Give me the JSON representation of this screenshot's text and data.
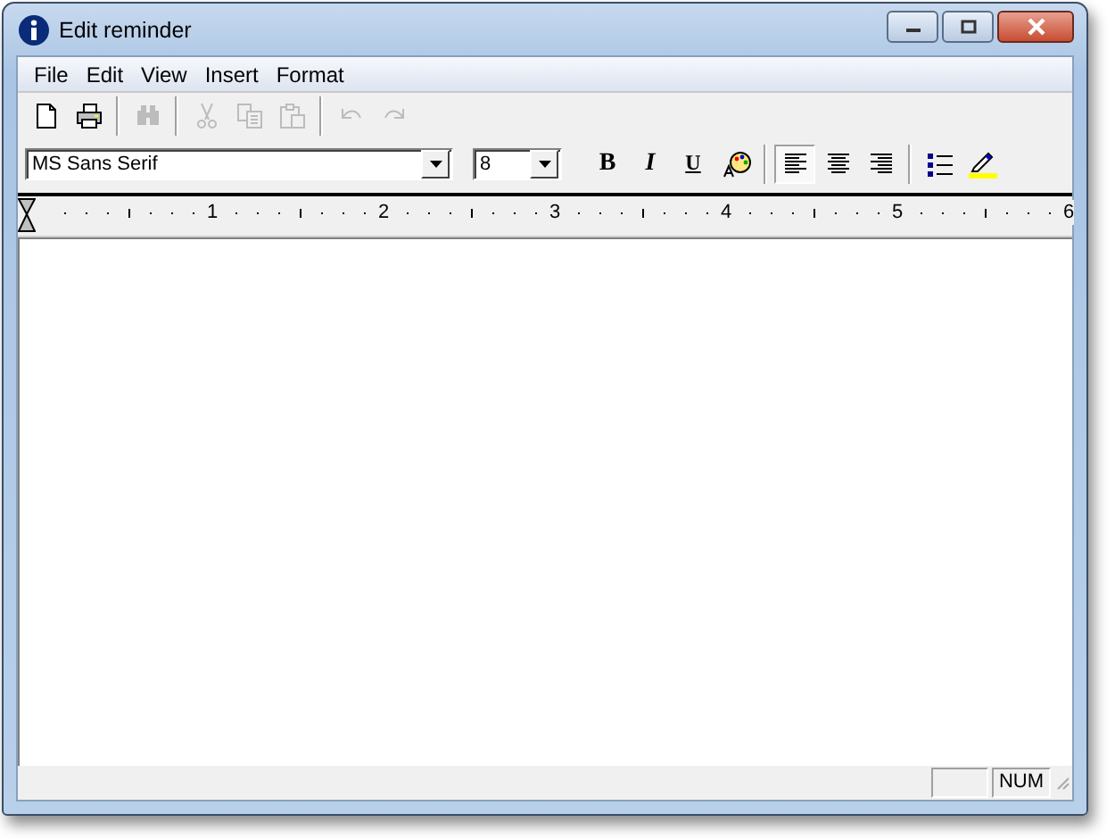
{
  "window": {
    "title": "Edit reminder"
  },
  "menu": [
    "File",
    "Edit",
    "View",
    "Insert",
    "Format"
  ],
  "toolbar": [
    {
      "kind": "new",
      "disabled": false
    },
    {
      "kind": "print",
      "disabled": false
    },
    {
      "kind": "sep"
    },
    {
      "kind": "find",
      "disabled": true
    },
    {
      "kind": "sep"
    },
    {
      "kind": "cut",
      "disabled": true
    },
    {
      "kind": "copy",
      "disabled": true
    },
    {
      "kind": "paste",
      "disabled": true
    },
    {
      "kind": "sep"
    },
    {
      "kind": "undo",
      "disabled": true
    },
    {
      "kind": "redo",
      "disabled": true
    }
  ],
  "format_bar": {
    "font": "MS Sans Serif",
    "size": "8",
    "style_buttons": [
      {
        "kind": "bold",
        "label": "B"
      },
      {
        "kind": "italic",
        "label": "I"
      },
      {
        "kind": "underline",
        "label": "U"
      }
    ],
    "align_buttons": [
      {
        "kind": "left",
        "selected": true
      },
      {
        "kind": "center",
        "selected": false
      },
      {
        "kind": "right",
        "selected": false
      }
    ]
  },
  "ruler": {
    "labels": [
      "1",
      "2",
      "3",
      "4",
      "5",
      "6"
    ]
  },
  "status_bar": {
    "num_indicator": "NUM"
  }
}
